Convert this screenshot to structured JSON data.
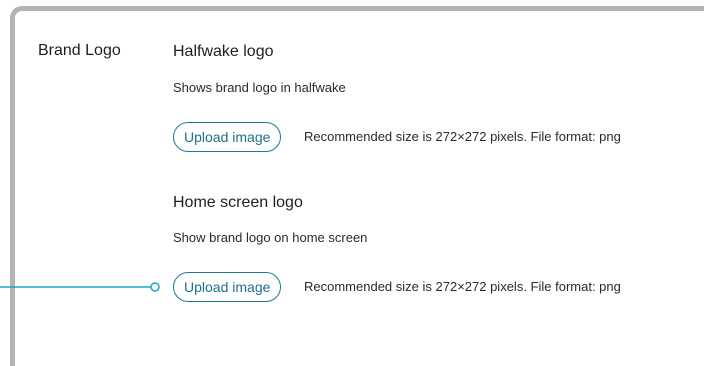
{
  "brand_logo": {
    "section_label": "Brand Logo",
    "settings": [
      {
        "title": "Halfwake logo",
        "description": "Shows brand logo in halfwake",
        "button_label": "Upload image",
        "hint": "Recommended size is 272×272 pixels. File format: png"
      },
      {
        "title": "Home screen logo",
        "description": "Show brand logo on home screen",
        "button_label": "Upload image",
        "hint": "Recommended size is 272×272 pixels. File format: png"
      }
    ]
  },
  "colors": {
    "accent": "#1e7a9a",
    "connector": "#1aa7c4",
    "panel_border": "#b3b3b3"
  }
}
